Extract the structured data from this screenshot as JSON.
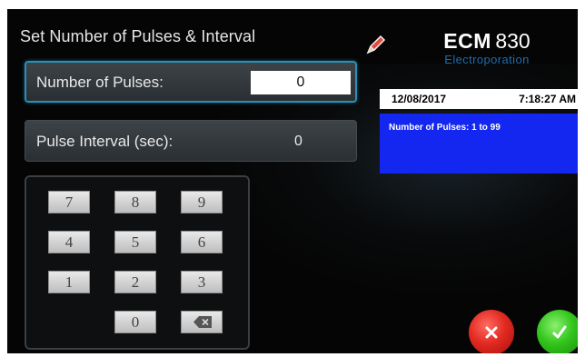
{
  "header": {
    "title": "Set Number of Pulses & Interval",
    "edit_icon": "pencil-icon"
  },
  "fields": {
    "pulses_label": "Number of Pulses:",
    "pulses_value": "0",
    "interval_label": "Pulse Interval (sec):",
    "interval_value": "0"
  },
  "keypad": {
    "keys": [
      "7",
      "8",
      "9",
      "4",
      "5",
      "6",
      "1",
      "2",
      "3",
      "0"
    ],
    "backspace_icon": "backspace-icon"
  },
  "brand": {
    "name": "ECM",
    "model": "830",
    "subtitle": "Electroporation"
  },
  "status": {
    "date": "12/08/2017",
    "time": "7:18:27 AM",
    "message": "Number of Pulses: 1 to 99"
  },
  "actions": {
    "cancel_icon": "close-icon",
    "confirm_icon": "check-icon"
  },
  "colors": {
    "screen_bg": "#050505",
    "active_border": "#2a8fb6",
    "message_bg": "#1427f0",
    "subtitle": "#1f6cae",
    "cancel": "#e22a21",
    "confirm": "#32c51c"
  }
}
